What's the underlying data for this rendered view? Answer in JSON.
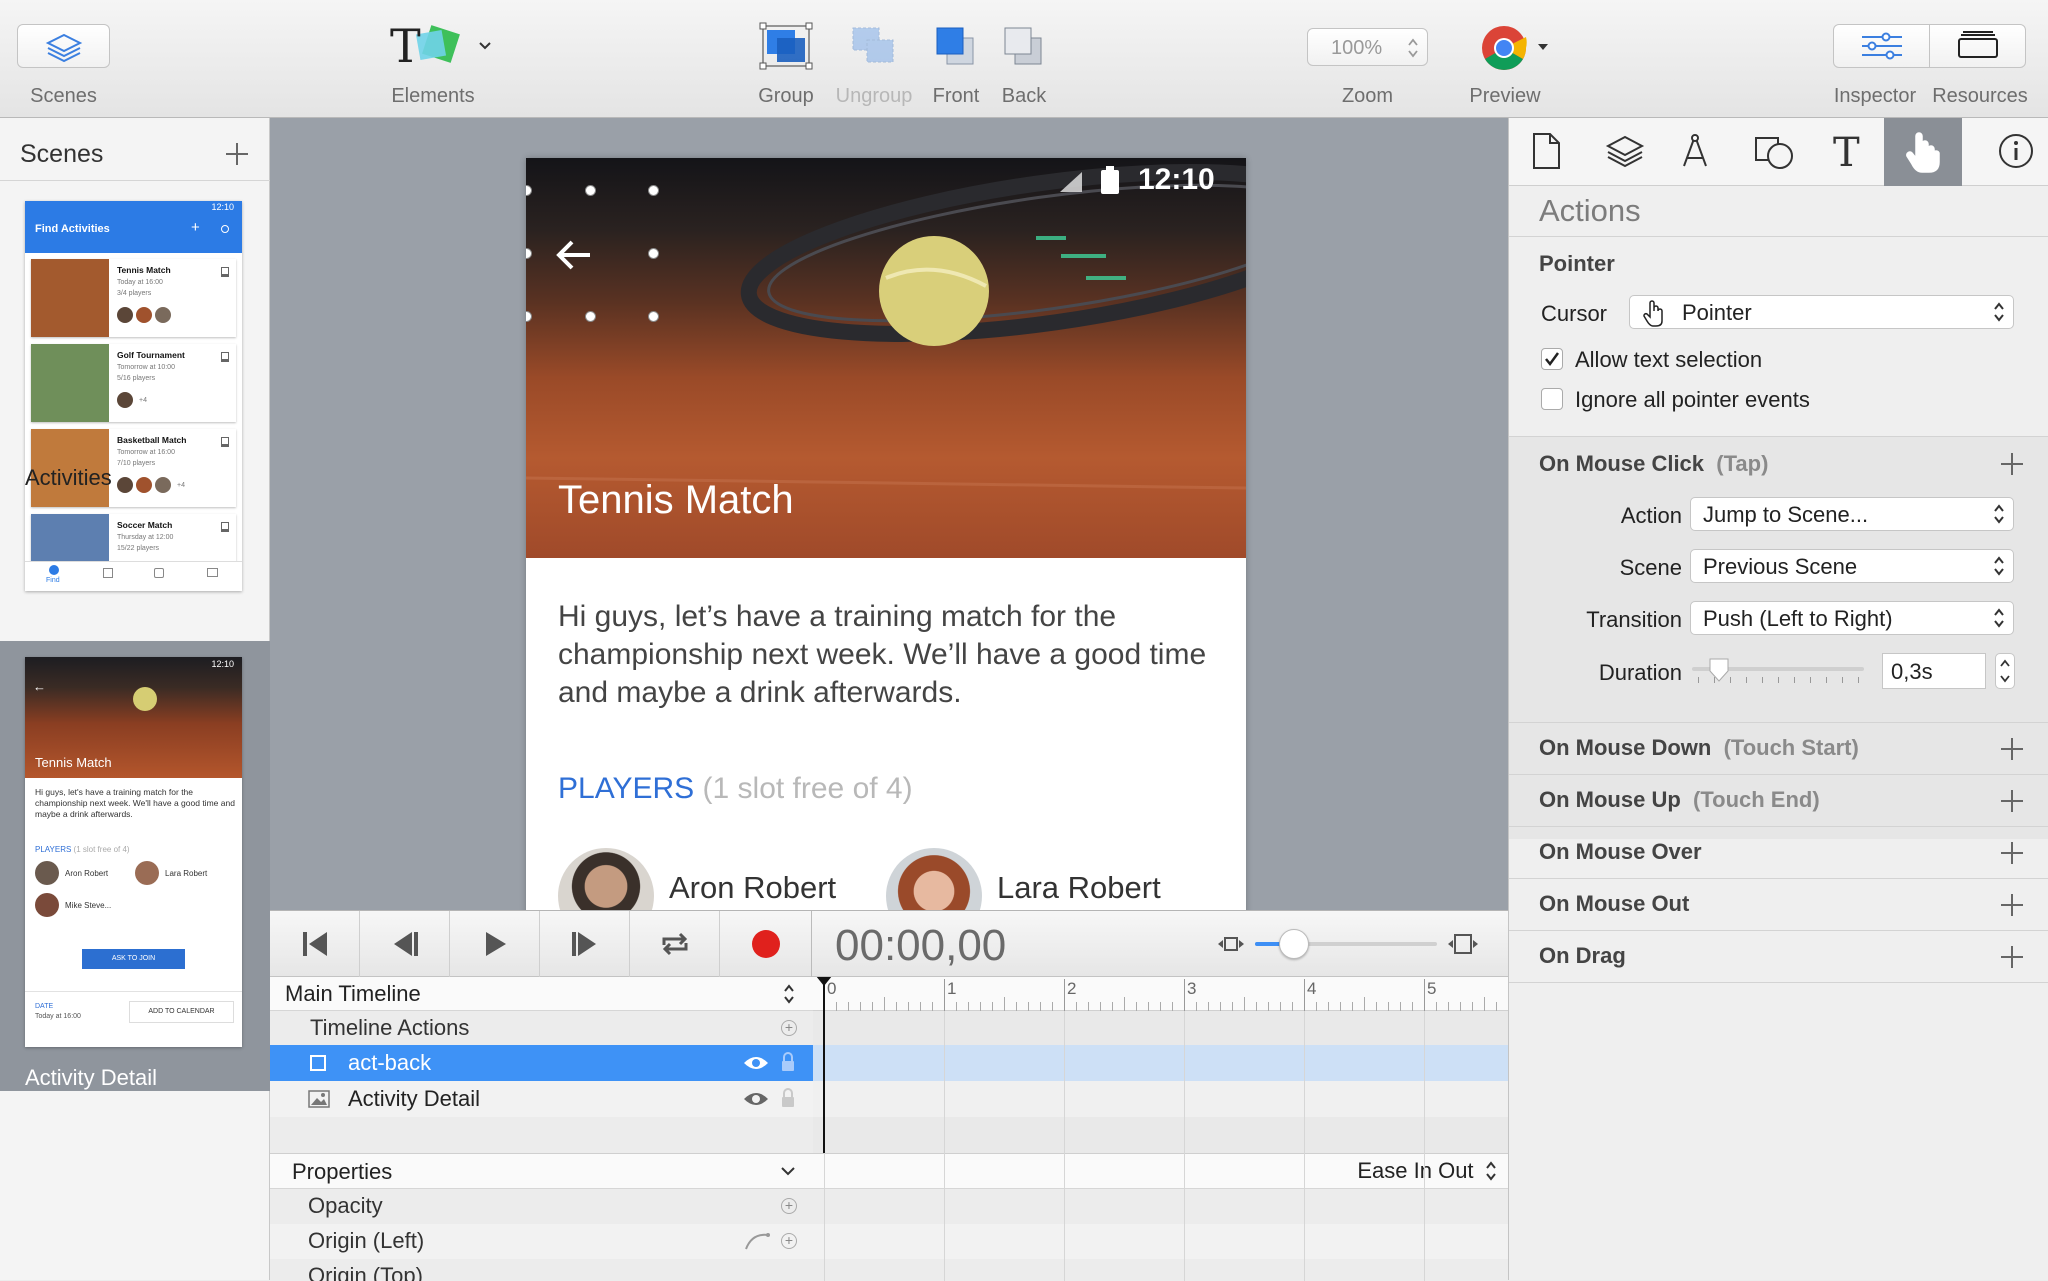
{
  "toolbar": {
    "scenes": "Scenes",
    "elements": "Elements",
    "group": "Group",
    "ungroup": "Ungroup",
    "front": "Front",
    "back": "Back",
    "zoom_value": "100%",
    "zoom": "Zoom",
    "preview": "Preview",
    "inspector": "Inspector",
    "resources": "Resources"
  },
  "scenes_panel": {
    "title": "Scenes",
    "scenes": [
      {
        "label": "Activities",
        "selected": false
      },
      {
        "label": "Activity Detail",
        "selected": true
      }
    ],
    "thumb1": {
      "time": "12:10",
      "header": "Find Activities",
      "items": [
        {
          "title": "Tennis Match",
          "line1": "Today at 16:00",
          "line2": "3/4 players"
        },
        {
          "title": "Golf Tournament",
          "line1": "Tomorrow at 10:00",
          "line2": "5/16 players",
          "extra": "+4"
        },
        {
          "title": "Basketball Match",
          "line1": "Tomorrow at 16:00",
          "line2": "7/10 players",
          "extra": "+4"
        },
        {
          "title": "Soccer Match",
          "line1": "Thursday at 12:00",
          "line2": "15/22 players"
        }
      ],
      "tab": "Find"
    },
    "thumb2": {
      "time": "12:10",
      "title": "Tennis Match",
      "desc": "Hi guys, let's have a training match for the championship next week. We'll have a good time and maybe a drink afterwards.",
      "players": "PLAYERS",
      "slots": "(1 slot free of 4)",
      "p1": "Aron Robert",
      "p2": "Lara Robert",
      "p3": "Mike Steve...",
      "join": "ASK TO JOIN",
      "date_label": "DATE",
      "date_value": "Today at 16:00",
      "calendar": "ADD TO CALENDAR"
    }
  },
  "phone": {
    "time": "12:10",
    "title": "Tennis Match",
    "description": "Hi guys, let’s have a training match for the championship next week. We’ll have a good time and maybe a drink afterwards.",
    "players_label": "PLAYERS",
    "players_slots": "(1 slot free of 4)",
    "player1": "Aron Robert",
    "player2": "Lara Robert"
  },
  "timeline": {
    "timecode": "00:00,00",
    "main_timeline": "Main Timeline",
    "timeline_actions": "Timeline Actions",
    "layers": [
      {
        "name": "act-back",
        "selected": true
      },
      {
        "name": "Activity Detail",
        "selected": false
      }
    ],
    "properties": "Properties",
    "easing": "Ease In Out",
    "props": [
      "Opacity",
      "Origin (Left)",
      "Origin (Top)"
    ],
    "ticks": [
      "0",
      "1",
      "2",
      "3",
      "4",
      "5"
    ]
  },
  "inspector": {
    "title": "Actions",
    "pointer_section": "Pointer",
    "cursor_label": "Cursor",
    "cursor_value": "Pointer",
    "allow_text": "Allow text selection",
    "allow_text_checked": true,
    "ignore_events": "Ignore all pointer events",
    "ignore_events_checked": false,
    "mouse_click": "On Mouse Click",
    "mouse_click_sub": "(Tap)",
    "action_label": "Action",
    "action_value": "Jump to Scene...",
    "scene_label": "Scene",
    "scene_value": "Previous Scene",
    "transition_label": "Transition",
    "transition_value": "Push (Left to Right)",
    "duration_label": "Duration",
    "duration_value": "0,3s",
    "mouse_down": "On Mouse Down",
    "mouse_down_sub": "(Touch Start)",
    "mouse_up": "On Mouse Up",
    "mouse_up_sub": "(Touch End)",
    "mouse_over": "On Mouse Over",
    "mouse_out": "On Mouse Out",
    "drag": "On Drag"
  },
  "colors": {
    "accent": "#3d8ff5",
    "selection_row": "#3e92f6",
    "record": "#e0211d",
    "players": "#2f6fd6"
  }
}
